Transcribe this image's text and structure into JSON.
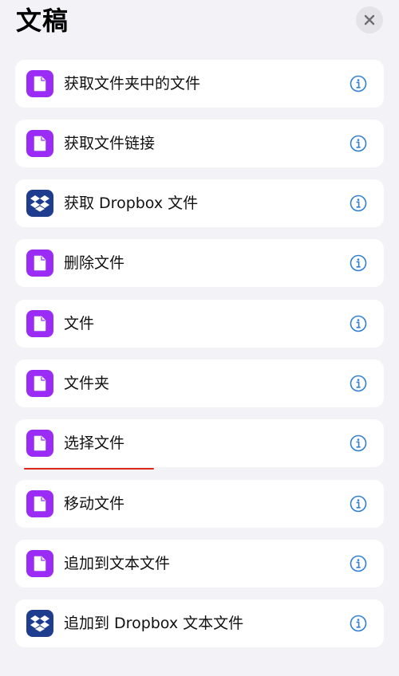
{
  "header": {
    "title": "文稿"
  },
  "actions": [
    {
      "label": "获取文件夹中的文件",
      "icon": "file-icon"
    },
    {
      "label": "获取文件链接",
      "icon": "file-icon"
    },
    {
      "label": "获取 Dropbox 文件",
      "icon": "dropbox-icon"
    },
    {
      "label": "删除文件",
      "icon": "file-icon"
    },
    {
      "label": "文件",
      "icon": "file-icon"
    },
    {
      "label": "文件夹",
      "icon": "file-icon"
    },
    {
      "label": "选择文件",
      "icon": "file-icon"
    },
    {
      "label": "移动文件",
      "icon": "file-icon"
    },
    {
      "label": "追加到文本文件",
      "icon": "file-icon"
    },
    {
      "label": "追加到 Dropbox 文本文件",
      "icon": "dropbox-icon"
    }
  ],
  "colors": {
    "file_icon_bg": "#9b2cf5",
    "dropbox_icon_bg": "#1f3d8f",
    "info_icon": "#2f7fd6",
    "highlight_underline": "#e0261c"
  }
}
